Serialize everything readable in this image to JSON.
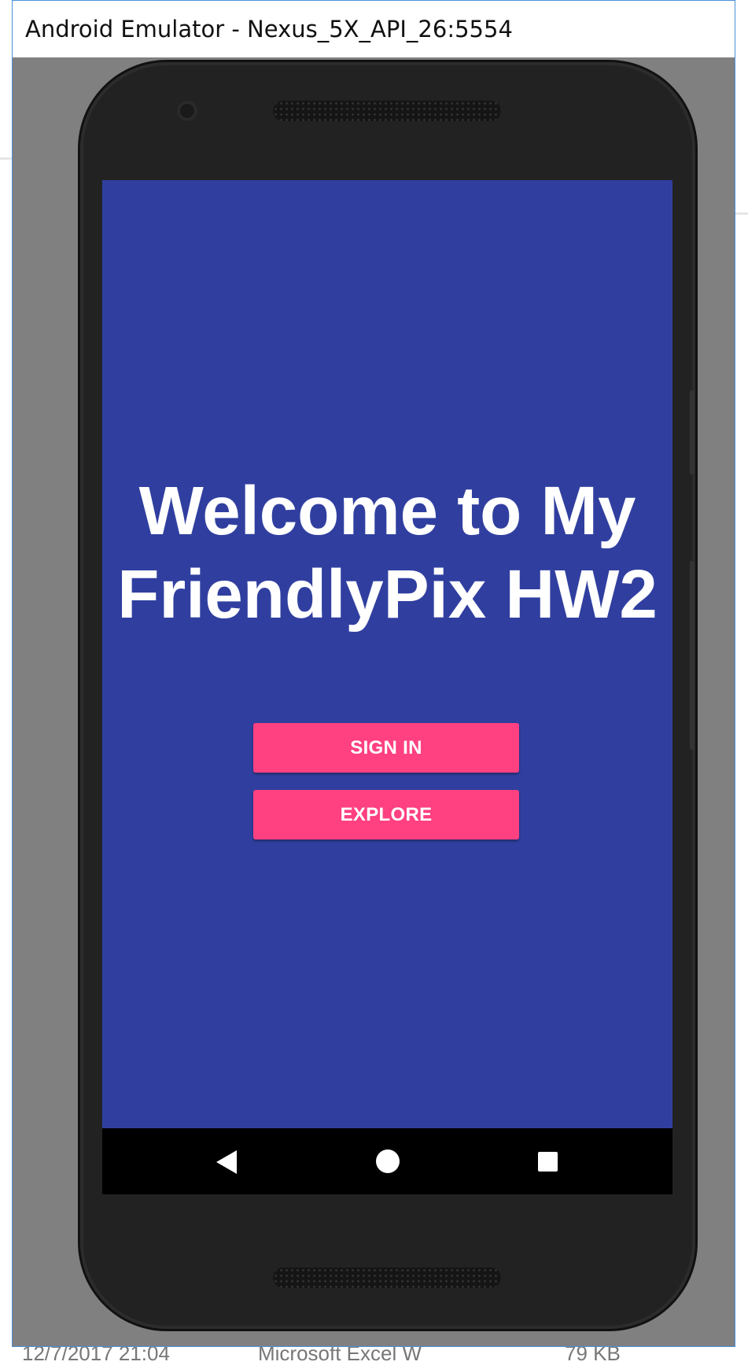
{
  "window": {
    "title": "Android Emulator - Nexus_5X_API_26:5554"
  },
  "app": {
    "welcome_line1": "Welcome to My",
    "welcome_line2": "FriendlyPix HW2",
    "sign_in_label": "SIGN IN",
    "explore_label": "EXPLORE",
    "colors": {
      "background": "#303f9f",
      "accent": "#ff4081",
      "text": "#ffffff"
    }
  },
  "nav_bar": {
    "icons": [
      "back-icon",
      "home-icon",
      "recents-icon"
    ]
  },
  "background": {
    "row_date": "12/7/2017 21:04",
    "row_type": "Microsoft Excel W",
    "row_size": "79 KB"
  }
}
